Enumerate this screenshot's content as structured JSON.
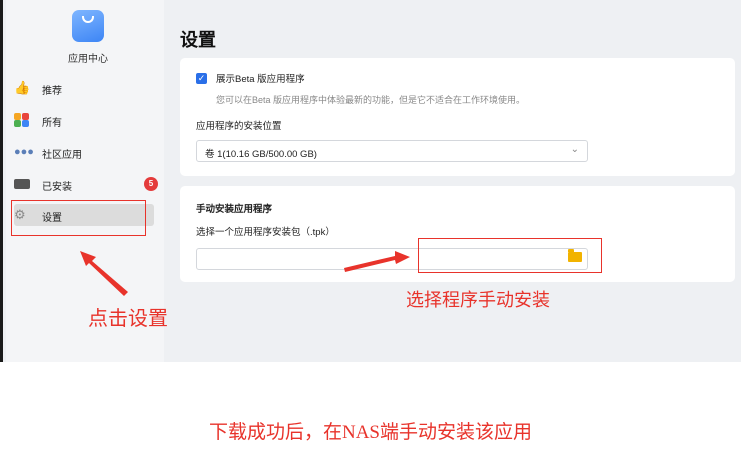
{
  "sidebar": {
    "app_center_label": "应用中心",
    "items": [
      {
        "label": "推荐",
        "icon": "thumbs-up-icon"
      },
      {
        "label": "所有",
        "icon": "app-grid-icon"
      },
      {
        "label": "社区应用",
        "icon": "community-icon"
      },
      {
        "label": "已安装",
        "icon": "drive-icon",
        "badge": "5"
      },
      {
        "label": "设置",
        "icon": "gear-icon",
        "active": true
      }
    ]
  },
  "main": {
    "title": "设置",
    "beta": {
      "checkbox_label": "展示Beta 版应用程序",
      "description": "您可以在Beta 版应用程序中体验最新的功能，但是它不适合在工作环境使用。",
      "checked": true
    },
    "install_location": {
      "label": "应用程序的安装位置",
      "selected": "卷 1(10.16 GB/500.00 GB)"
    },
    "manual_install": {
      "title": "手动安装应用程序",
      "hint": "选择一个应用程序安装包（.tpk）"
    }
  },
  "annotations": {
    "click_settings": "点击设置",
    "choose_program": "选择程序手动安装",
    "caption": "下载成功后，在NAS端手动安装该应用"
  },
  "colors": {
    "accent": "#2a6fe8",
    "annotation_red": "#e8332b",
    "badge_red": "#e43b3b",
    "folder_yellow": "#f2b300"
  }
}
